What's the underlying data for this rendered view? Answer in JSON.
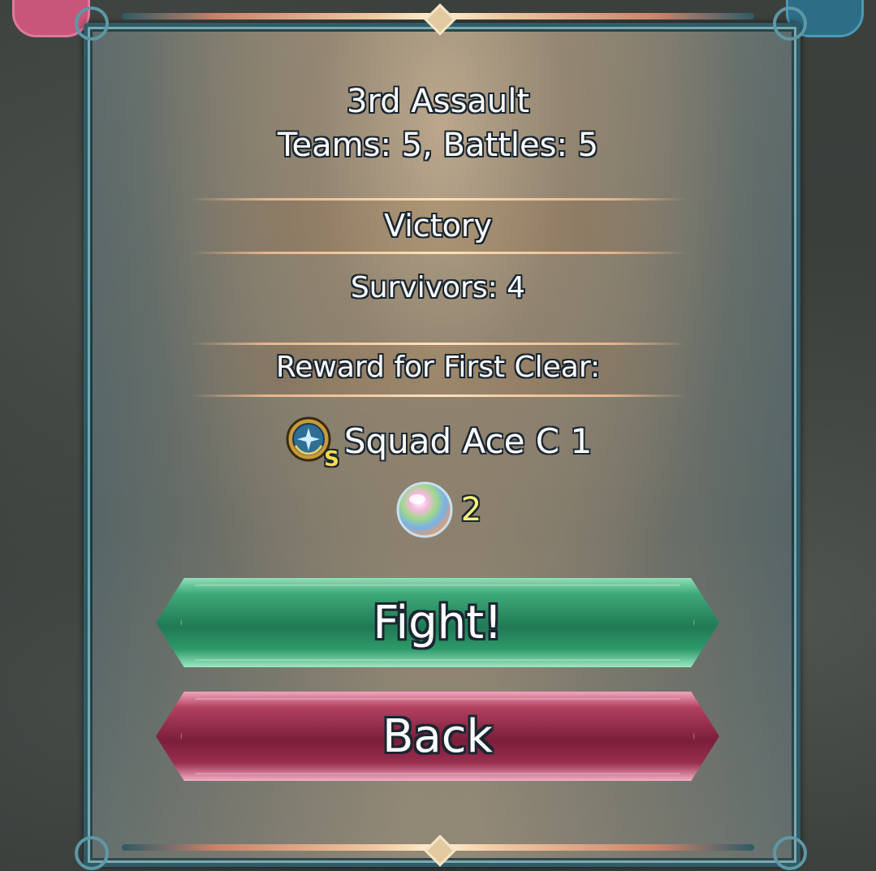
{
  "dialog": {
    "title": "3rd Assault",
    "teams_battles": "Teams: 5, Battles: 5",
    "result": "Victory",
    "survivors": "Survivors:  4",
    "reward_header": "Reward for First Clear:"
  },
  "rewards": [
    {
      "icon": "sacred-seal-icon",
      "icon_badge": "S",
      "name": "Squad Ace C 1",
      "qty": ""
    },
    {
      "icon": "orb-icon",
      "name": "",
      "qty": "2"
    }
  ],
  "buttons": {
    "fight_label": "Fight!",
    "back_label": "Back"
  },
  "colors": {
    "fight_button": "#2e9a6a",
    "back_button": "#9a2e4e",
    "frame": "#2f5a66",
    "qty_text": "#fff27a"
  }
}
